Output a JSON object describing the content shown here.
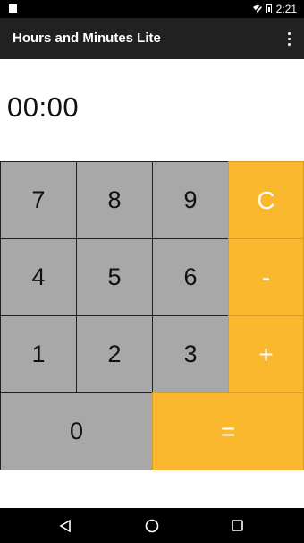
{
  "status_bar": {
    "time": "2:21"
  },
  "app_bar": {
    "title": "Hours and Minutes Lite"
  },
  "display": {
    "value": "00:00"
  },
  "keypad": {
    "keys": [
      "7",
      "8",
      "9",
      "C",
      "4",
      "5",
      "6",
      "-",
      "1",
      "2",
      "3",
      "+",
      "0",
      "="
    ]
  },
  "colors": {
    "number_key": "#a8a8a8",
    "operator_key": "#f9b82e",
    "app_bar": "#212121"
  }
}
